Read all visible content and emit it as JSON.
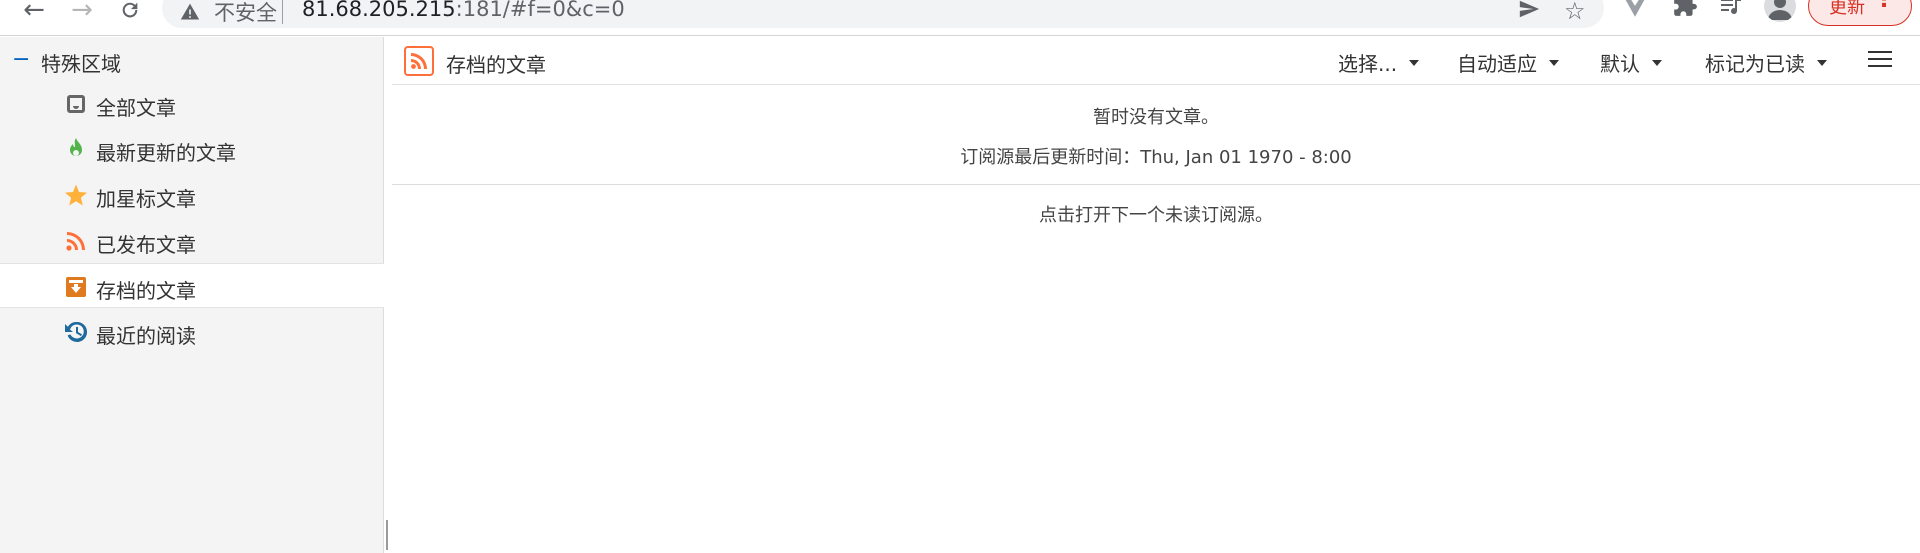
{
  "browser": {
    "security_label": "不安全",
    "url_host": "81.68.205.215",
    "url_rest": ":181/#f=0&c=0",
    "update_label": "更新"
  },
  "sidebar": {
    "category_toggle": "−",
    "category_title": "特殊区域",
    "items": [
      {
        "label": "全部文章",
        "icon": "inbox-icon",
        "color": "#666666"
      },
      {
        "label": "最新更新的文章",
        "icon": "fresh-flame-icon",
        "color": "#54b34a"
      },
      {
        "label": "加星标文章",
        "icon": "star-icon",
        "color": "#ffb13b"
      },
      {
        "label": "已发布文章",
        "icon": "rss-icon",
        "color": "#ff6f3a"
      },
      {
        "label": "存档的文章",
        "icon": "archive-icon",
        "color": "#e07a1f",
        "active": true
      },
      {
        "label": "最近的阅读",
        "icon": "history-icon",
        "color": "#1e6a9c"
      }
    ]
  },
  "toolbar": {
    "feed_title": "存档的文章",
    "select_label": "选择...",
    "autofit_label": "自动适应",
    "default_label": "默认",
    "markread_label": "标记为已读"
  },
  "content": {
    "empty_message": "暂时没有文章。",
    "last_updated": "订阅源最后更新时间：Thu, Jan 01 1970 - 8:00",
    "next_unread": "点击打开下一个未读订阅源。"
  },
  "colors": {
    "accent": "#0062be",
    "rss_orange": "#ff6f3a"
  }
}
